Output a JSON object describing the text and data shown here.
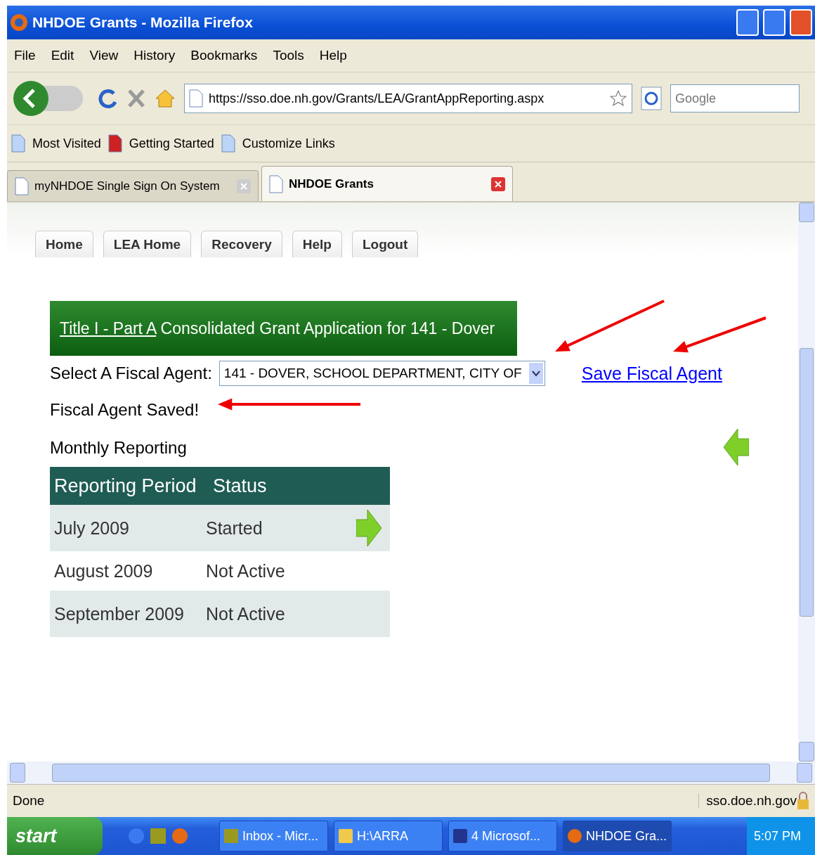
{
  "window": {
    "title": "NHDOE Grants - Mozilla Firefox"
  },
  "menu": [
    "File",
    "Edit",
    "View",
    "History",
    "Bookmarks",
    "Tools",
    "Help"
  ],
  "address": {
    "value": "https://sso.doe.nh.gov/Grants/LEA/GrantAppReporting.aspx"
  },
  "search": {
    "placeholder": "Google"
  },
  "bookmarks": [
    "Most Visited",
    "Getting Started",
    "Customize Links"
  ],
  "tabs": [
    {
      "label": "myNHDOE Single Sign On System",
      "selected": false
    },
    {
      "label": "NHDOE Grants",
      "selected": true
    }
  ],
  "site_nav": [
    "Home",
    "LEA Home",
    "Recovery",
    "Help",
    "Logout"
  ],
  "page": {
    "title_link": "Title I - Part A",
    "title_rest": " Consolidated Grant Application for 141 - Dover",
    "agent_label": "Select A Fiscal Agent:",
    "agent_value": "141 - DOVER, SCHOOL DEPARTMENT, CITY OF",
    "save_link": "Save Fiscal Agent",
    "saved_message": "Fiscal Agent Saved!",
    "section": "Monthly Reporting"
  },
  "table": {
    "columns": [
      "Reporting Period",
      "Status"
    ],
    "rows": [
      {
        "period": "July 2009",
        "status": "Started",
        "action": true
      },
      {
        "period": "August 2009",
        "status": "Not Active",
        "action": false
      },
      {
        "period": "September 2009",
        "status": "Not Active",
        "action": false
      }
    ]
  },
  "status_bar": {
    "text": "Done",
    "host": "sso.doe.nh.gov"
  },
  "taskbar": {
    "start": "start",
    "items": [
      {
        "label": "Inbox - Micr...",
        "kind": "mail",
        "selected": false
      },
      {
        "label": "H:\\ARRA",
        "kind": "folder",
        "selected": false
      },
      {
        "label": "4 Microsof...",
        "kind": "word",
        "selected": false
      },
      {
        "label": "NHDOE Gra...",
        "kind": "browser",
        "selected": true
      }
    ],
    "clock": "5:07 PM"
  }
}
